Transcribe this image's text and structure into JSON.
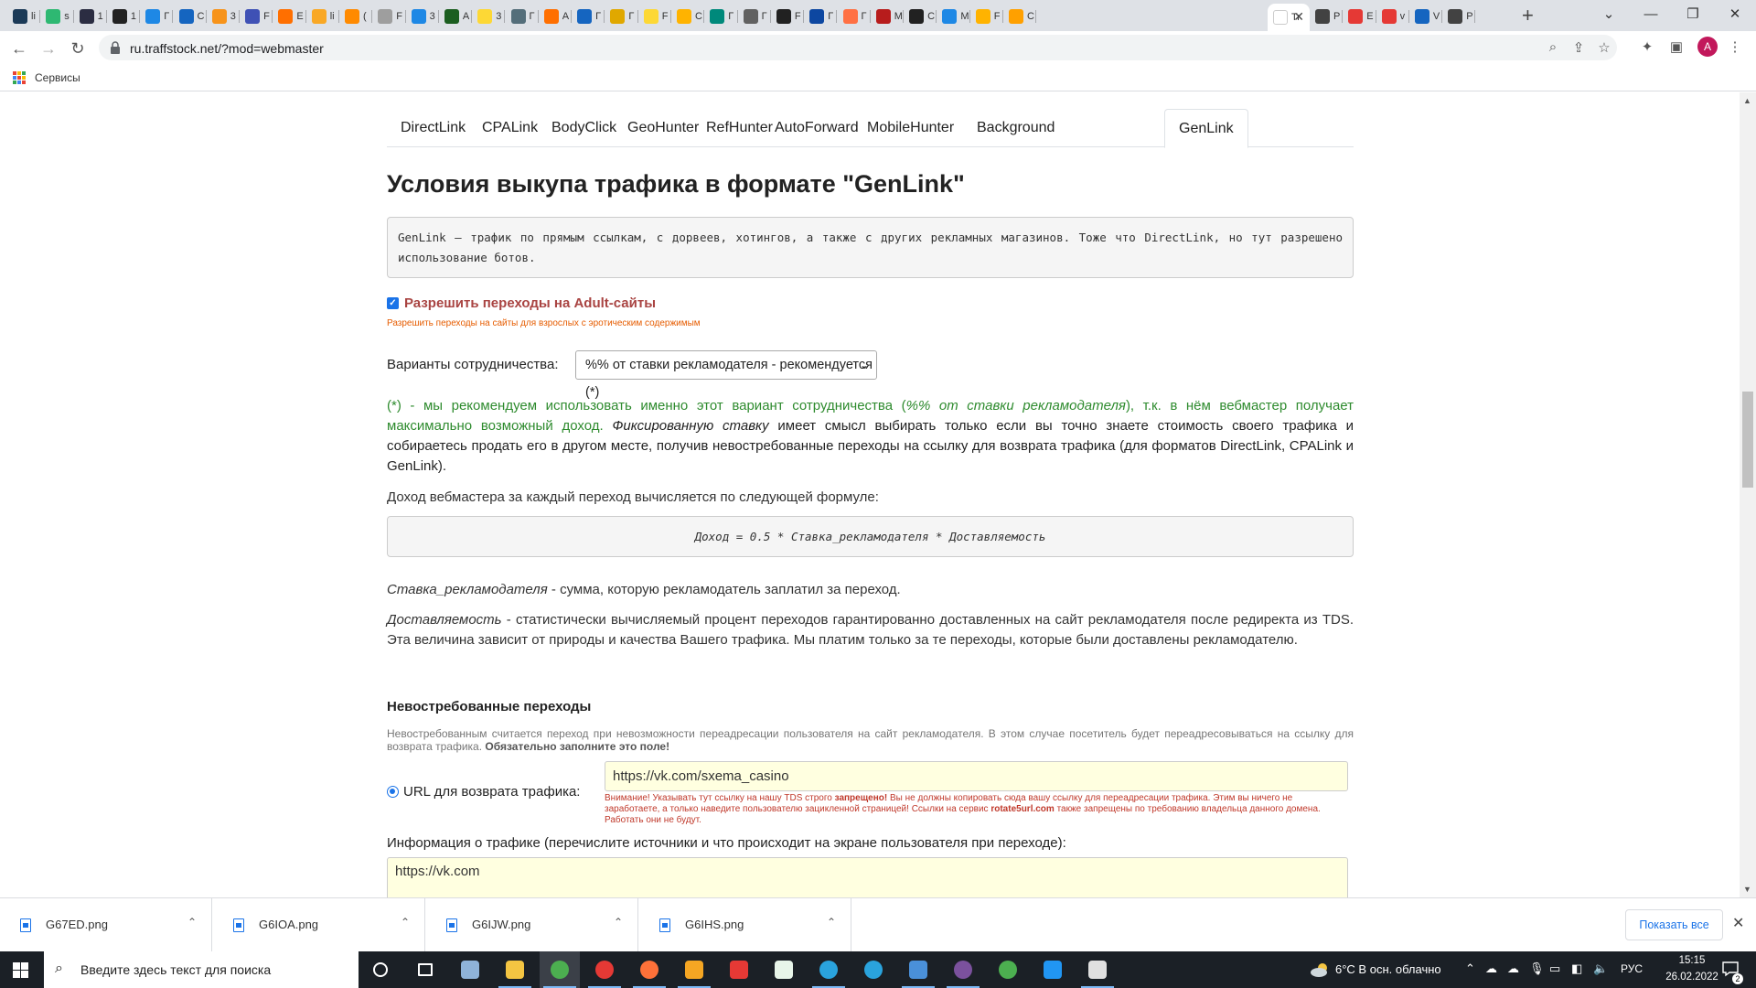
{
  "browser": {
    "tabs": [
      {
        "label": "li",
        "color": "#1b3a57"
      },
      {
        "label": "s",
        "color": "#2eb872"
      },
      {
        "label": "1",
        "color": "#2b2d42"
      },
      {
        "label": "1",
        "color": "#222222"
      },
      {
        "label": "Г",
        "color": "#1e88e5"
      },
      {
        "label": "С",
        "color": "#1565c0"
      },
      {
        "label": "3",
        "color": "#f7931a"
      },
      {
        "label": "F",
        "color": "#3f51b5"
      },
      {
        "label": "Е",
        "color": "#ff6f00"
      },
      {
        "label": "li",
        "color": "#f9a825"
      },
      {
        "label": "(",
        "color": "#ff8a00"
      },
      {
        "label": "F",
        "color": "#9e9e9e"
      },
      {
        "label": "3",
        "color": "#1e88e5"
      },
      {
        "label": "A",
        "color": "#1b5e20"
      },
      {
        "label": "3",
        "color": "#fdd835"
      },
      {
        "label": "Г",
        "color": "#546e7a"
      },
      {
        "label": "A",
        "color": "#ff6f00"
      },
      {
        "label": "Г",
        "color": "#1565c0"
      },
      {
        "label": "Г",
        "color": "#e0a800"
      },
      {
        "label": "F",
        "color": "#fdd835"
      },
      {
        "label": "С",
        "color": "#ffb300"
      },
      {
        "label": "Г",
        "color": "#00897b"
      },
      {
        "label": "Г",
        "color": "#616161"
      },
      {
        "label": "F",
        "color": "#212121"
      },
      {
        "label": "Г",
        "color": "#0d47a1"
      },
      {
        "label": "Г",
        "color": "#ff7043"
      },
      {
        "label": "M",
        "color": "#b71c1c"
      },
      {
        "label": "С",
        "color": "#212121"
      },
      {
        "label": "M",
        "color": "#1e88e5"
      },
      {
        "label": "F",
        "color": "#ffb300"
      },
      {
        "label": "С",
        "color": "#ffa000"
      }
    ],
    "active_tab": {
      "label": "Tr",
      "color": "#ffffff"
    },
    "tabs_after": [
      {
        "label": "Р",
        "color": "#424242"
      },
      {
        "label": "Е",
        "color": "#e53935"
      },
      {
        "label": "v",
        "color": "#e53935"
      },
      {
        "label": "V",
        "color": "#1565c0"
      },
      {
        "label": "Р",
        "color": "#424242"
      }
    ],
    "new_tab_glyph": "+",
    "url": "ru.traffstock.net/?mod=webmaster",
    "bookmarks_apps_label": "Сервисы",
    "profile_initial": "A",
    "icons": [
      "back-icon",
      "forward-icon",
      "reload-icon",
      "lock-icon",
      "zoom-icon",
      "share-icon",
      "star-icon",
      "extensions-icon",
      "sidepanel-icon",
      "menu-icon"
    ]
  },
  "page": {
    "nav_tabs": [
      "DirectLink",
      "CPALink",
      "BodyClick",
      "GeoHunter",
      "RefHunter",
      "AutoForward",
      "MobileHunter",
      "Background",
      "GenLink"
    ],
    "active_nav_tab": "GenLink",
    "title": "Условия выкупа трафика в формате \"GenLink\"",
    "description": "GenLink – трафик по прямым ссылкам, с дорвеев, хотингов, а также с других рекламных магазинов. Тоже что DirectLink, но тут разрешено использование ботов.",
    "adult_checkbox": {
      "checked": true,
      "label": "Разрешить переходы на Adult-сайты",
      "hint": "Разрешить переходы на сайты для взрослых с эротическим содержимым"
    },
    "cooperation": {
      "label": "Варианты сотрудничества:",
      "selected": "%% от ставки рекламодателя - рекомендуется (*)"
    },
    "recommendation": {
      "part1": "(*) - мы рекомендуем использовать именно этот вариант сотрудничества (",
      "part1_em": "%% от ставки рекламодателя",
      "part2": "), т.к. в нём вебмастер получает максимально возможный доход. ",
      "part3_em": "Фиксированную ставку",
      "part4": " имеет смысл выбирать только если вы точно знаете стоимость своего трафика и собираетесь продать его в другом месте, получив невостребованные переходы на ссылку для возврата трафика (для форматов DirectLink, CPALink и GenLink)."
    },
    "income_intro": "Доход вебмастера за каждый переход вычисляется по следующей формуле:",
    "formula": "Доход = 0.5 * Ставка_рекламодателя * Доставляемость",
    "stavka": {
      "term": "Ставка_рекламодателя",
      "text": " - сумма, которую рекламодатель заплатил за переход."
    },
    "dostavlyaemost": {
      "term": "Доставляемость",
      "text": " - статистически вычисляемый процент переходов гарантированно доставленных на сайт рекламодателя после редиректа из TDS. Эта величина зависит от природы и качества Вашего трафика. Мы платим только за те переходы, которые были доставлены рекламодателю."
    },
    "unclaimed": {
      "title": "Невостребованные переходы",
      "desc": "Невостребованным считается переход при невозможности переадресации пользователя на сайт рекламодателя. В этом случае посетитель будет переадресовываться на ссылку для возврата трафика. ",
      "desc_bold": "Обязательно заполните это поле!"
    },
    "return_url": {
      "label": "URL для возврата трафика:",
      "value": "https://vk.com/sxema_casino",
      "warning_1": "Внимание! Указывать тут ссылку на нашу TDS строго ",
      "warning_bold_1": "запрещено!",
      "warning_2": " Вы не должны копировать сюда вашу ссылку для переадресации трафика. Этим вы ничего не заработаете, а только наведите пользователю зацикленной страницей! Ссылки на сервис ",
      "warning_bold_2": "rotate5url.com",
      "warning_3": " также запрещены по требованию владельца данного домена. Работать они не будут."
    },
    "traffic_info": {
      "label": "Информация о трафике (перечислите источники и что происходит на экране пользователя при переходе):",
      "value": "https://vk.com"
    }
  },
  "downloads": {
    "items": [
      "G67ED.png",
      "G6IOA.png",
      "G6IJW.png",
      "G6IHS.png"
    ],
    "show_all": "Показать все"
  },
  "taskbar": {
    "search_placeholder": "Введите здесь текст для поиска",
    "weather": "6°C  В осн. облачно",
    "lang": "РУС",
    "time": "15:15",
    "date": "26.02.2022",
    "notifications": "2",
    "apps": [
      {
        "name": "cortana-icon",
        "color": "#1b2026"
      },
      {
        "name": "taskview-icon",
        "color": "#1b2026"
      },
      {
        "name": "notepad-icon",
        "color": "#8fb3d9"
      },
      {
        "name": "explorer-icon",
        "color": "#f4c542"
      },
      {
        "name": "chrome-icon",
        "color": "#4caf50"
      },
      {
        "name": "yandex-browser-icon",
        "color": "#e53935"
      },
      {
        "name": "firefox-icon",
        "color": "#ff7139"
      },
      {
        "name": "archicad-icon",
        "color": "#f5a623"
      },
      {
        "name": "yandex-icon",
        "color": "#e53935"
      },
      {
        "name": "excel-icon",
        "color": "#e8f5e9"
      },
      {
        "name": "telegram-icon",
        "color": "#2aa3dd"
      },
      {
        "name": "telegram2-icon",
        "color": "#2aa3dd"
      },
      {
        "name": "app-icon",
        "color": "#4a90d9"
      },
      {
        "name": "viber-icon",
        "color": "#7b519d"
      },
      {
        "name": "xbox-icon",
        "color": "#4caf50"
      },
      {
        "name": "gem-icon",
        "color": "#2196f3"
      },
      {
        "name": "window-icon",
        "color": "#e0e0e0"
      }
    ]
  }
}
